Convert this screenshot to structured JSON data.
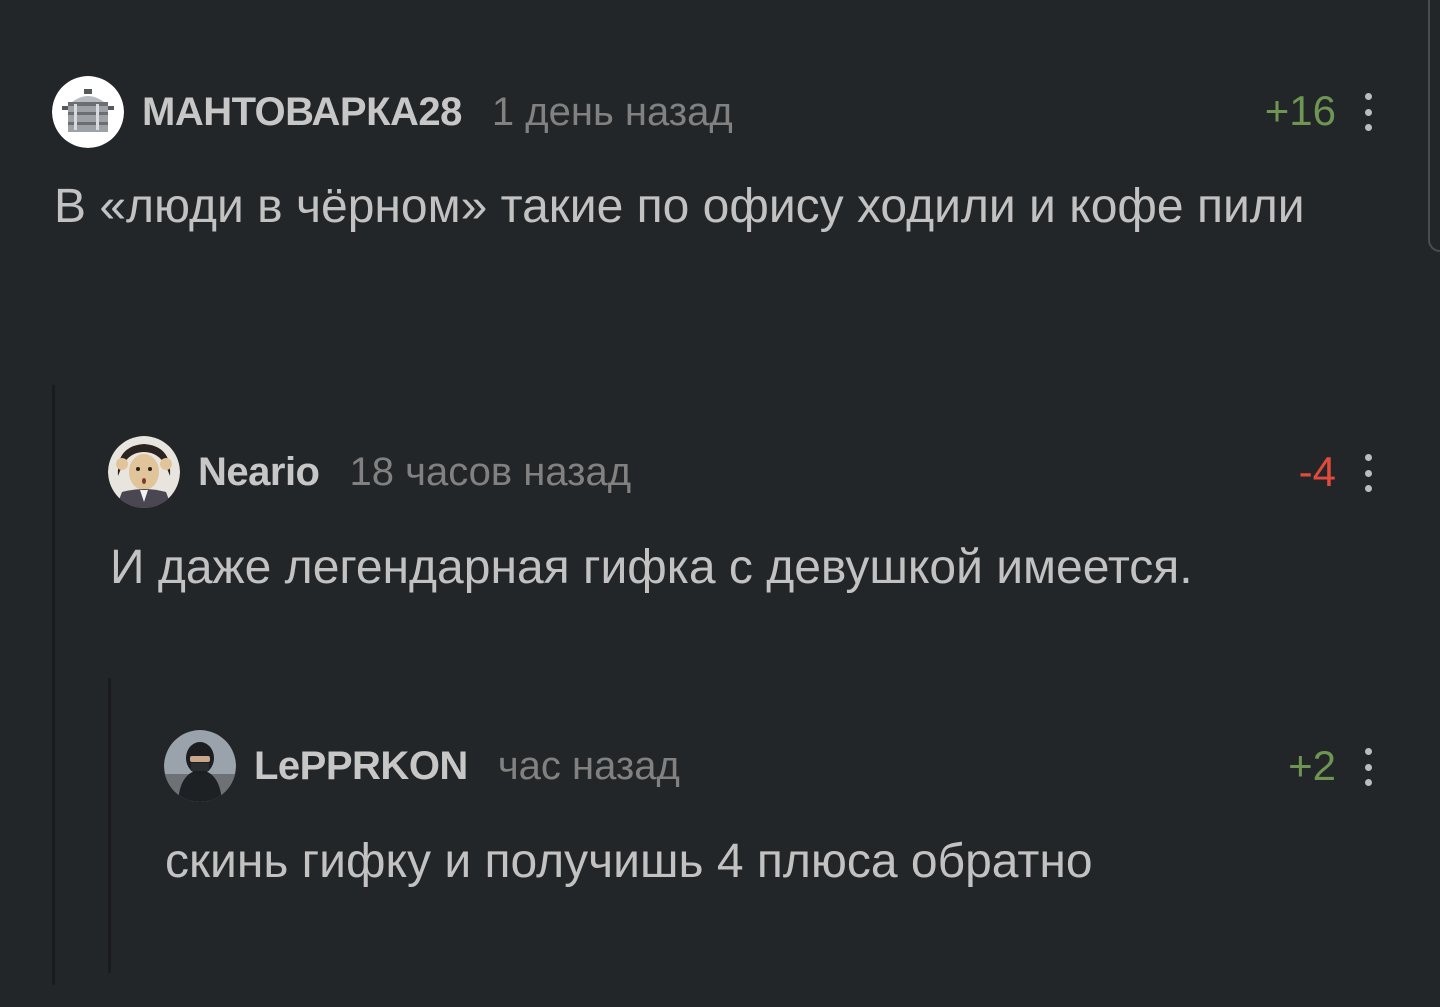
{
  "comments": [
    {
      "username": "МАНТОВАРКА28",
      "time": "1 день назад",
      "rating": "+16",
      "text": "В «люди в чёрном» такие по офису ходили и кофе пили",
      "avatar_icon": "steamer-pot-icon"
    },
    {
      "username": "Neario",
      "time": "18 часов назад",
      "rating": "-4",
      "text": "И даже легендарная гифка с девушкой имеется.",
      "avatar_icon": "anime-character-avatar"
    },
    {
      "username": "LePPRKON",
      "time": "час назад",
      "rating": "+2",
      "text": "скинь гифку и получишь 4 плюса обратно",
      "avatar_icon": "hooded-person-avatar"
    }
  ],
  "colors": {
    "background": "#232629",
    "positive": "#6f9552",
    "negative": "#e24a3b",
    "text": "#c2c2c2",
    "meta": "#818181"
  }
}
